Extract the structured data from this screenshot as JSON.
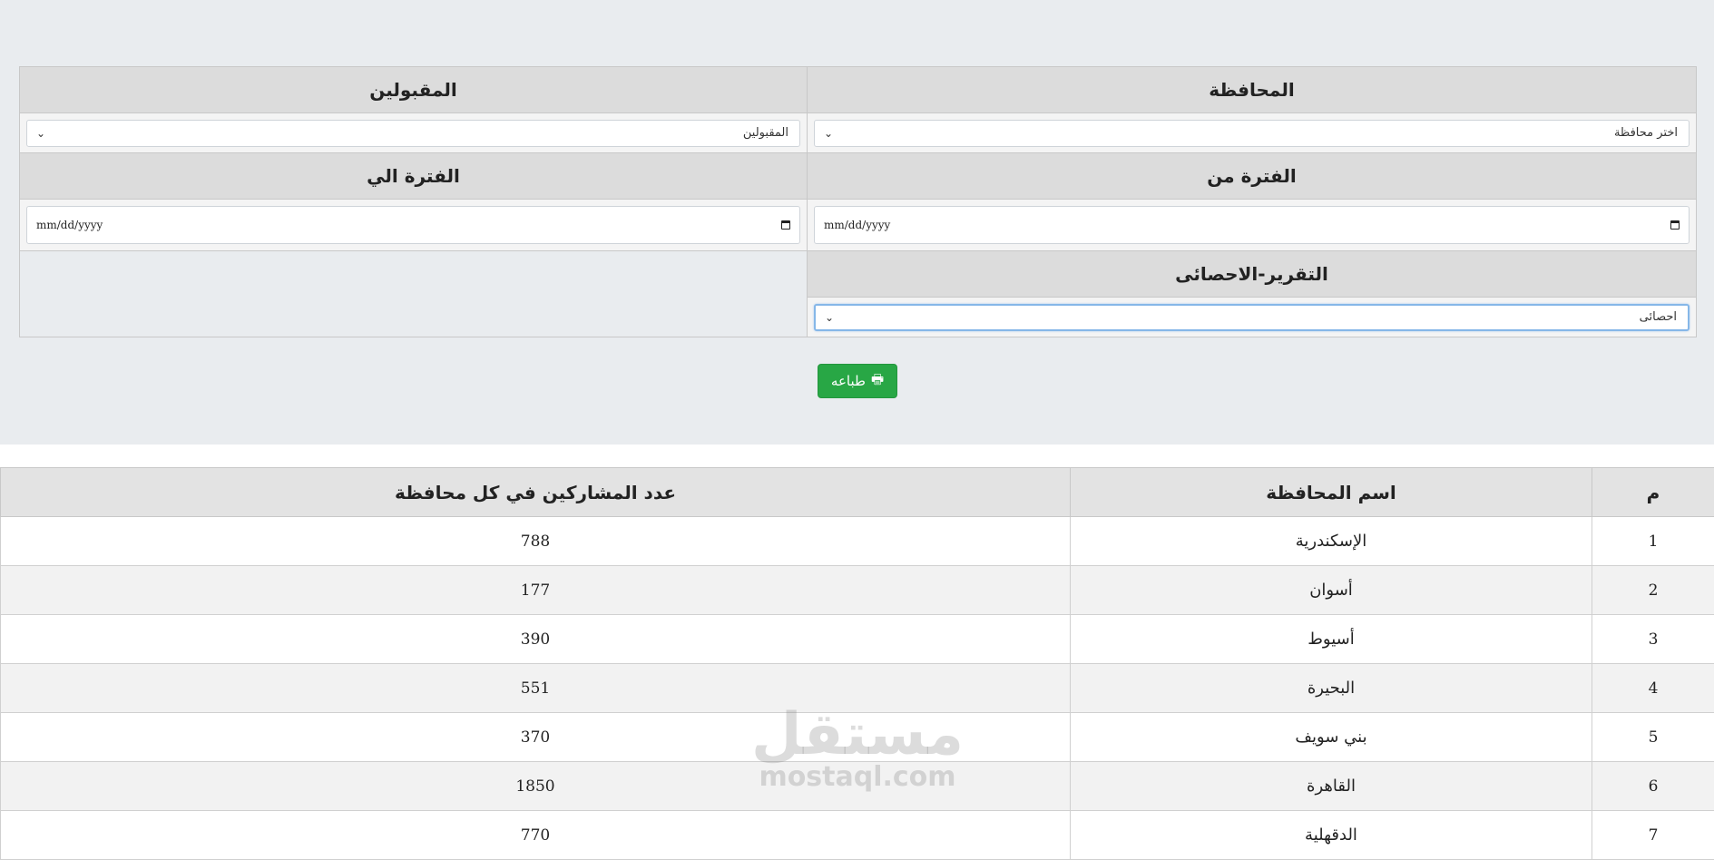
{
  "filters": {
    "governorate_label": "المحافظة",
    "accepted_label": "المقبولين",
    "governorate_placeholder": "اختر محافظة",
    "accepted_value": "المقبولين",
    "period_from_label": "الفترة من",
    "period_to_label": "الفترة الي",
    "date_placeholder": "mm/dd/yyyy",
    "report_label": "التقرير-الاحصائى",
    "report_value": "احصائى"
  },
  "print_button": {
    "label": "طباعه",
    "icon": "print-icon"
  },
  "table": {
    "headers": [
      "م",
      "اسم المحافظة",
      "عدد المشاركين في كل محافظة"
    ],
    "rows": [
      {
        "index": "1",
        "name": "الإسكندرية",
        "count": "788"
      },
      {
        "index": "2",
        "name": "أسوان",
        "count": "177"
      },
      {
        "index": "3",
        "name": "أسيوط",
        "count": "390"
      },
      {
        "index": "4",
        "name": "البحيرة",
        "count": "551"
      },
      {
        "index": "5",
        "name": "بني سويف",
        "count": "370"
      },
      {
        "index": "6",
        "name": "القاهرة",
        "count": "1850"
      },
      {
        "index": "7",
        "name": "الدقهلية",
        "count": "770"
      }
    ]
  },
  "watermark": {
    "arabic": "مستقل",
    "latin": "mostaql.com"
  },
  "colors": {
    "print_button": "#28a745",
    "header_bg": "#dcdcdc",
    "page_bg": "#e9ecef"
  }
}
